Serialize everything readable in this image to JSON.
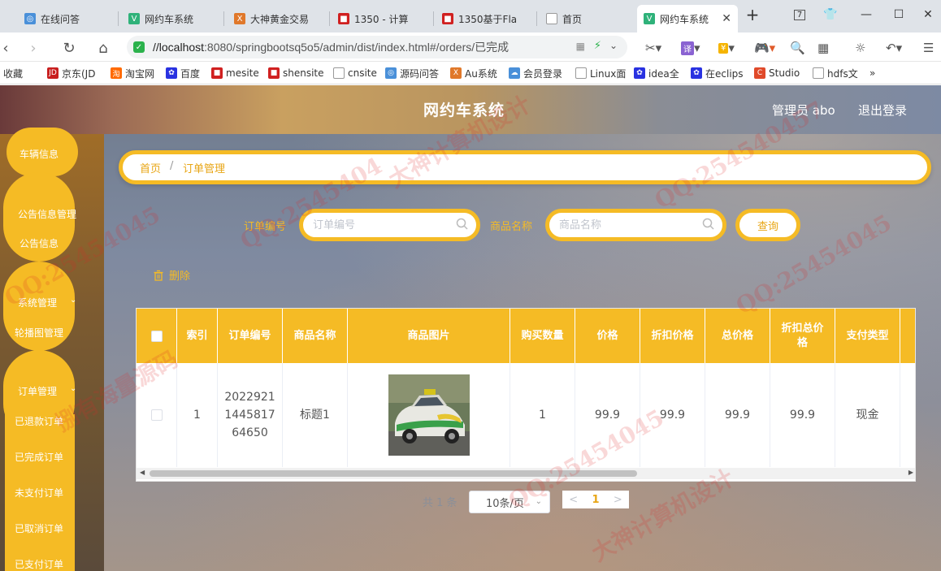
{
  "browser": {
    "tabs": [
      {
        "title": "在线问答"
      },
      {
        "title": "网约车系统"
      },
      {
        "title": "大神黄金交易"
      },
      {
        "title": "1350 - 计算"
      },
      {
        "title": "1350基于Fla"
      },
      {
        "title": "首页"
      },
      {
        "title": "网约车系统"
      }
    ],
    "tab_badge": "7",
    "url_host": "//localhost",
    "url_rest": ":8080/springbootsq5o5/admin/dist/index.html#/orders/已完成",
    "bookmarks": [
      {
        "label": "收藏"
      },
      {
        "label": "京东(JD"
      },
      {
        "label": "淘宝网"
      },
      {
        "label": "百度"
      },
      {
        "label": "mesite"
      },
      {
        "label": "shensite"
      },
      {
        "label": "cnsite"
      },
      {
        "label": "源码问答"
      },
      {
        "label": "Au系统"
      },
      {
        "label": "会员登录"
      },
      {
        "label": "Linux面"
      },
      {
        "label": "idea全"
      },
      {
        "label": "在eclips"
      },
      {
        "label": "Studio"
      },
      {
        "label": "hdfs文"
      }
    ],
    "more_bookmarks": "»"
  },
  "app": {
    "title": "网约车系统",
    "admin_label": "管理员 abo",
    "logout": "退出登录"
  },
  "sidebar": {
    "items": [
      {
        "label": "车辆信息"
      },
      {
        "label": "公告信息管理"
      },
      {
        "label": "公告信息"
      },
      {
        "label": "系统管理"
      },
      {
        "label": "轮播图管理"
      },
      {
        "label": "订单管理"
      },
      {
        "label": "已退款订单"
      },
      {
        "label": "已完成订单"
      },
      {
        "label": "未支付订单"
      },
      {
        "label": "已取消订单"
      },
      {
        "label": "已支付订单"
      }
    ]
  },
  "breadcrumb": {
    "home": "首页",
    "sep": "/",
    "current": "订单管理"
  },
  "search": {
    "order_no_label": "订单编号",
    "order_no_placeholder": "订单编号",
    "product_label": "商品名称",
    "product_placeholder": "商品名称",
    "query_button": "查询"
  },
  "actions": {
    "delete": "删除"
  },
  "table": {
    "headers": [
      "索引",
      "订单编号",
      "商品名称",
      "商品图片",
      "购买数量",
      "价格",
      "折扣价格",
      "总价格",
      "折扣总价格",
      "支付类型"
    ],
    "rows": [
      {
        "index": "1",
        "order_no_lines": [
          "2022921",
          "1445817",
          "64650"
        ],
        "product_name": "标题1",
        "image": "taxi-photo",
        "quantity": "1",
        "price": "99.9",
        "discount_price": "99.9",
        "total_price": "99.9",
        "discount_total": "99.9",
        "payment_type": "现金"
      }
    ]
  },
  "pagination": {
    "total": "共 1 条",
    "page_size": "10条/页",
    "prev": "<",
    "current_page": "1",
    "next": ">"
  },
  "watermark": {
    "texts": [
      "QQ:25454045",
      "大神计算机设计",
      "QQ:2545404",
      "QQ:25454045",
      "捌有海量源码",
      "大神计算机设计",
      "QQ:25454045",
      "QQ:254540457"
    ]
  },
  "colors": {
    "accent": "#f5bb25",
    "accent_text": "#e8a616"
  }
}
